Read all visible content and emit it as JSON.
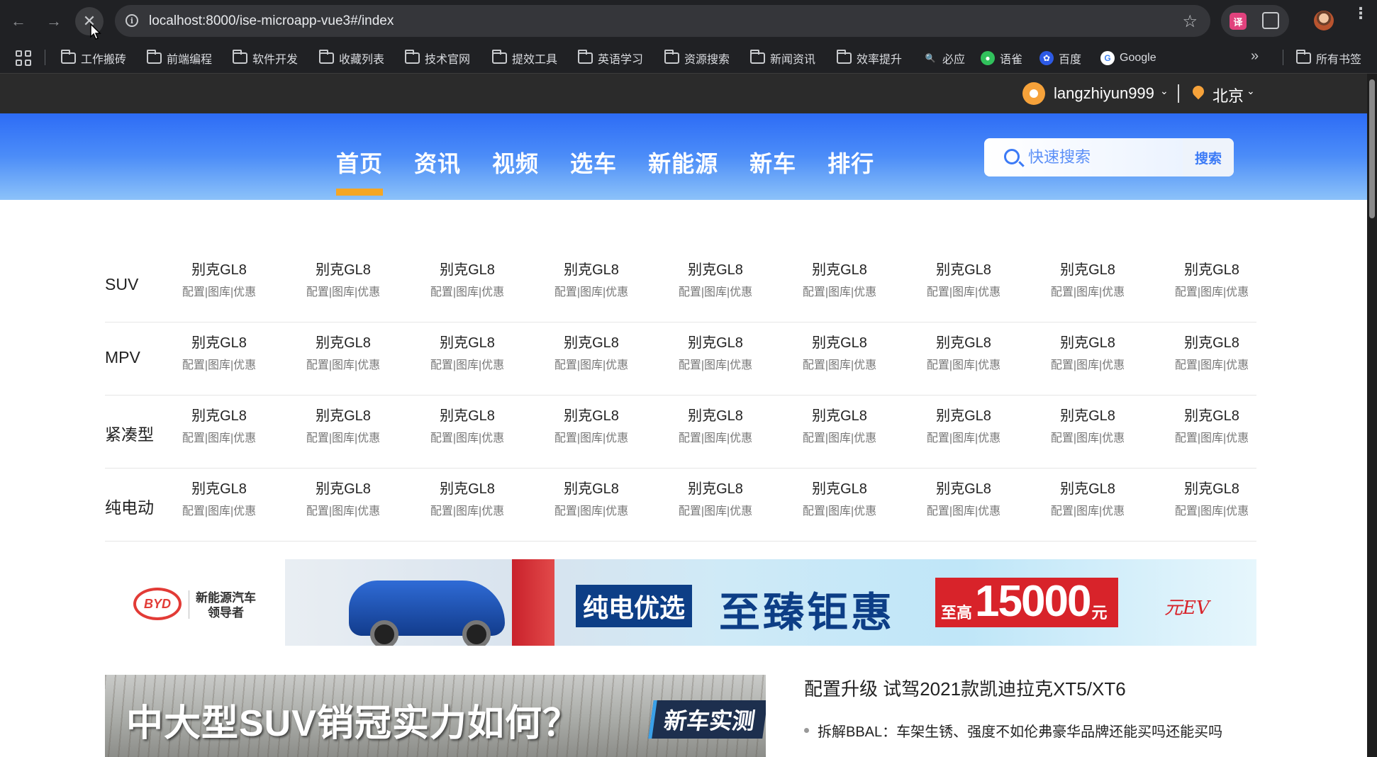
{
  "browser": {
    "url": "localhost:8000/ise-microapp-vue3#/index",
    "bookmarks": [
      {
        "label": "工作搬砖",
        "icon": "folder-icon"
      },
      {
        "label": "前端编程",
        "icon": "folder-icon"
      },
      {
        "label": "软件开发",
        "icon": "folder-icon"
      },
      {
        "label": "收藏列表",
        "icon": "folder-icon"
      },
      {
        "label": "技术官网",
        "icon": "folder-icon"
      },
      {
        "label": "提效工具",
        "icon": "folder-icon"
      },
      {
        "label": "英语学习",
        "icon": "folder-icon"
      },
      {
        "label": "资源搜索",
        "icon": "folder-icon"
      },
      {
        "label": "新闻资讯",
        "icon": "folder-icon"
      },
      {
        "label": "效率提升",
        "icon": "folder-icon"
      },
      {
        "label": "必应",
        "icon": "bing-icon"
      },
      {
        "label": "语雀",
        "icon": "yuque-icon"
      },
      {
        "label": "百度",
        "icon": "baidu-icon"
      },
      {
        "label": "Google",
        "icon": "google-icon"
      }
    ],
    "all_bookmarks": "所有书签"
  },
  "topbar": {
    "username": "langzhiyun999",
    "city": "北京"
  },
  "nav": {
    "items": [
      "首页",
      "资讯",
      "视频",
      "选车",
      "新能源",
      "新车",
      "排行"
    ],
    "active": "首页"
  },
  "search": {
    "placeholder": "快速搜索",
    "button": "搜索"
  },
  "car_table": {
    "rows": [
      {
        "category": "SUV",
        "cars": [
          "别克GL8",
          "别克GL8",
          "别克GL8",
          "别克GL8",
          "别克GL8",
          "别克GL8",
          "别克GL8",
          "别克GL8",
          "别克GL8"
        ]
      },
      {
        "category": "MPV",
        "cars": [
          "别克GL8",
          "别克GL8",
          "别克GL8",
          "别克GL8",
          "别克GL8",
          "别克GL8",
          "别克GL8",
          "别克GL8",
          "别克GL8"
        ]
      },
      {
        "category": "紧凑型",
        "cars": [
          "别克GL8",
          "别克GL8",
          "别克GL8",
          "别克GL8",
          "别克GL8",
          "别克GL8",
          "别克GL8",
          "别克GL8",
          "别克GL8"
        ]
      },
      {
        "category": "纯电动",
        "cars": [
          "别克GL8",
          "别克GL8",
          "别克GL8",
          "别克GL8",
          "别克GL8",
          "别克GL8",
          "别克GL8",
          "别克GL8",
          "别克GL8"
        ]
      }
    ],
    "links": [
      "配置",
      "图库",
      "优惠"
    ]
  },
  "ad": {
    "brand_logo": "BYD",
    "brand_tagline_1": "新能源汽车",
    "brand_tagline_2": "领导者",
    "slogan1": "纯电优选",
    "slogan2": "至臻钜惠",
    "price_prefix": "至高",
    "price_value": "15000",
    "price_suffix": "元",
    "ev_mark": "元EV"
  },
  "feature": {
    "title": "中大型SUV销冠实力如何？",
    "tag": "新车实测"
  },
  "news": {
    "headline": "配置升级 试驾2021款凯迪拉克XT5/XT6",
    "items": [
      "拆解BBAL：车架生锈、强度不如伦弗豪华品牌还能买吗还能买吗"
    ]
  },
  "colors": {
    "accent": "#2d6cf6",
    "active_underline": "#f5a623",
    "brand_red": "#d8232a"
  }
}
